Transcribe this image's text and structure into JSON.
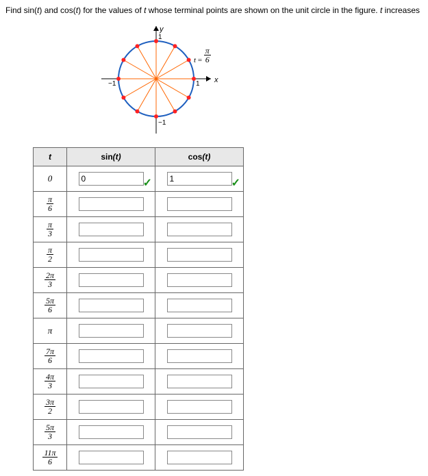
{
  "instruction": {
    "pre": "Find sin(",
    "var1": "t",
    "mid1": ") and cos(",
    "var2": "t",
    "mid2": ") for the values of ",
    "var3": "t",
    "mid3": " whose terminal points are shown on the unit circle in the figure. ",
    "var4": "t",
    "post": " increases in increme"
  },
  "axis": {
    "y": "y",
    "x": "x",
    "one": "1",
    "neg_one_x": "−1",
    "neg_one_y": "−1"
  },
  "angle_label": {
    "var": "t",
    "eq": " = ",
    "num": "π",
    "den": "6"
  },
  "headers": {
    "t": "t",
    "sin_fn": "sin",
    "sin_arg": "(t)",
    "cos_fn": "cos",
    "cos_arg": "(t)"
  },
  "rows": [
    {
      "t_plain": "0",
      "sin": "0",
      "cos": "1",
      "sin_ok": true,
      "cos_ok": true
    },
    {
      "t_num": "π",
      "t_den": "6",
      "sin": "",
      "cos": ""
    },
    {
      "t_num": "π",
      "t_den": "3",
      "sin": "",
      "cos": ""
    },
    {
      "t_num": "π",
      "t_den": "2",
      "sin": "",
      "cos": ""
    },
    {
      "t_num": "2π",
      "t_den": "3",
      "sin": "",
      "cos": ""
    },
    {
      "t_num": "5π",
      "t_den": "6",
      "sin": "",
      "cos": ""
    },
    {
      "t_plain": "π",
      "sin": "",
      "cos": ""
    },
    {
      "t_num": "7π",
      "t_den": "6",
      "sin": "",
      "cos": ""
    },
    {
      "t_num": "4π",
      "t_den": "3",
      "sin": "",
      "cos": ""
    },
    {
      "t_num": "3π",
      "t_den": "2",
      "sin": "",
      "cos": ""
    },
    {
      "t_num": "5π",
      "t_den": "3",
      "sin": "",
      "cos": ""
    },
    {
      "t_num": "11π",
      "t_den": "6",
      "sin": "",
      "cos": ""
    }
  ]
}
